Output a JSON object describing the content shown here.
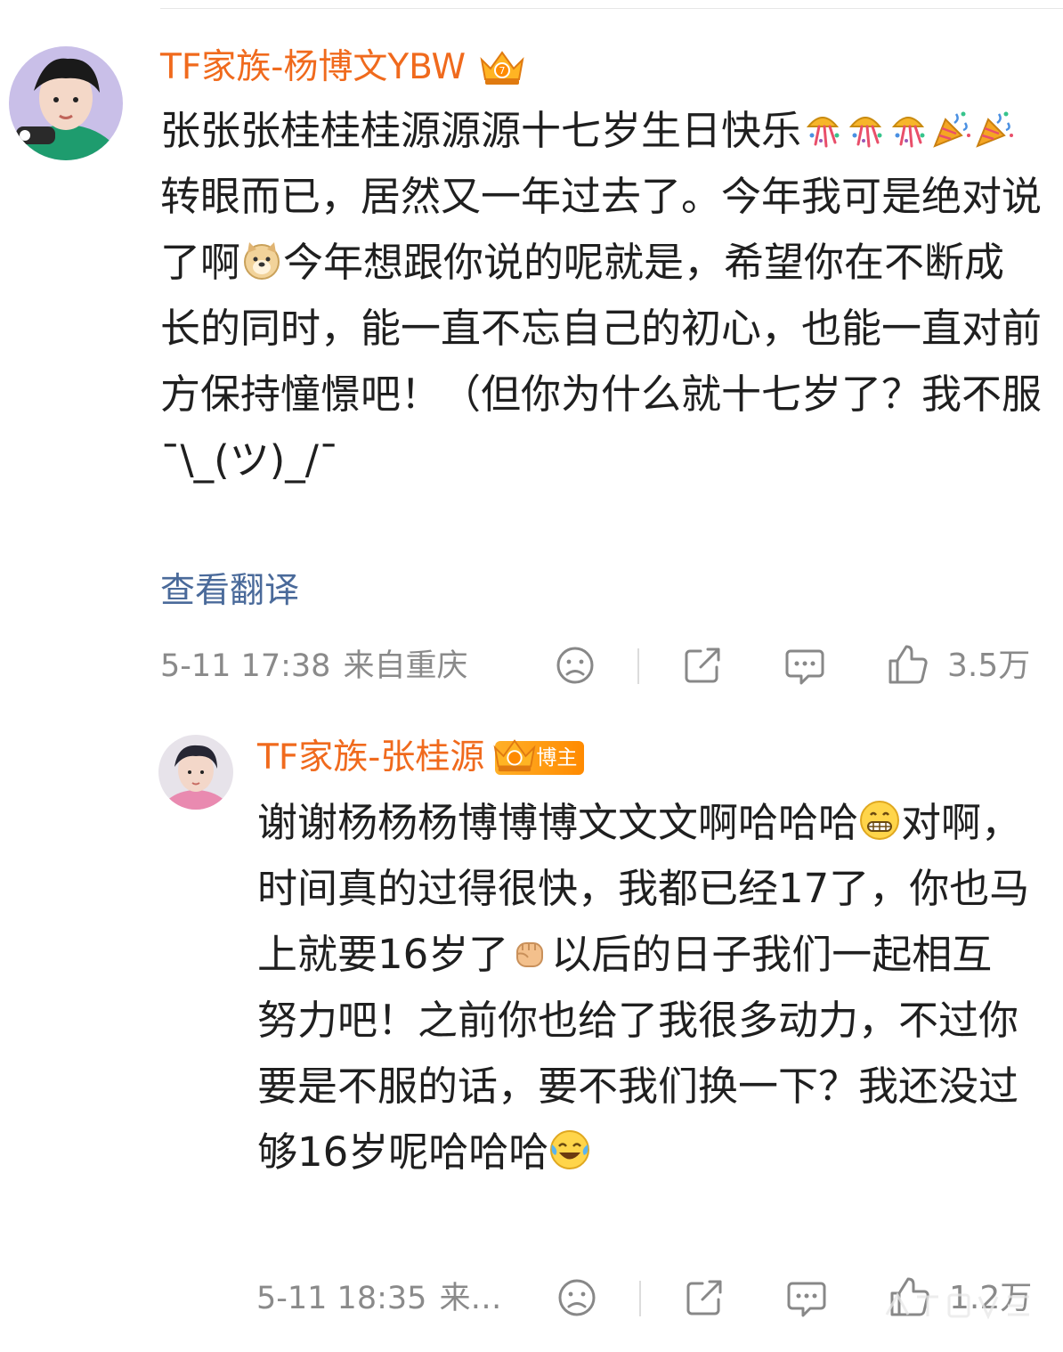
{
  "main_comment": {
    "username": "TF家族-杨博文YBW",
    "badge_icon": "crown-badge-icon",
    "segments": [
      {
        "text": "张张张桂桂桂源源源十七岁生日快乐"
      },
      {
        "emoji": "confetti"
      },
      {
        "emoji": "confetti"
      },
      {
        "emoji": "confetti"
      },
      {
        "emoji": "party"
      },
      {
        "emoji": "party"
      },
      {
        "text": "转眼而已，居然又一年过去了。今年我可是绝对说了啊"
      },
      {
        "emoji": "doge"
      },
      {
        "text": "今年想跟你说的呢就是，希望你在不断成长的同时，能一直不忘自己的初心，也能一直对前方保持憧憬吧！（但你为什么就十七岁了？我不服¯\\_(ツ)_/¯"
      }
    ],
    "translate_label": "查看翻译",
    "time": "5-11 17:38",
    "location": "来自重庆",
    "like_count": "3.5万"
  },
  "reply_comment": {
    "username": "TF家族-张桂源",
    "badge_icon": "crown-badge-icon",
    "badge_label": "博主",
    "segments": [
      {
        "text": "谢谢杨杨杨博博博文文文啊哈哈哈"
      },
      {
        "emoji": "grin"
      },
      {
        "text": "对啊，时间真的过得很快，我都已经17了，你也马上就要16岁了"
      },
      {
        "emoji": "fist"
      },
      {
        "text": "以后的日子我们一起相互努力吧！之前你也给了我很多动力，不过你要是不服的话，要不我们换一下？我还没过够16岁呢哈哈哈"
      },
      {
        "emoji": "laugh-cry"
      }
    ],
    "time": "5-11 18:35",
    "location": "来…",
    "like_count": "1.2万"
  },
  "colors": {
    "username": "#f06a1d",
    "link": "#4a6a9a",
    "meta": "#8a8a8a"
  }
}
